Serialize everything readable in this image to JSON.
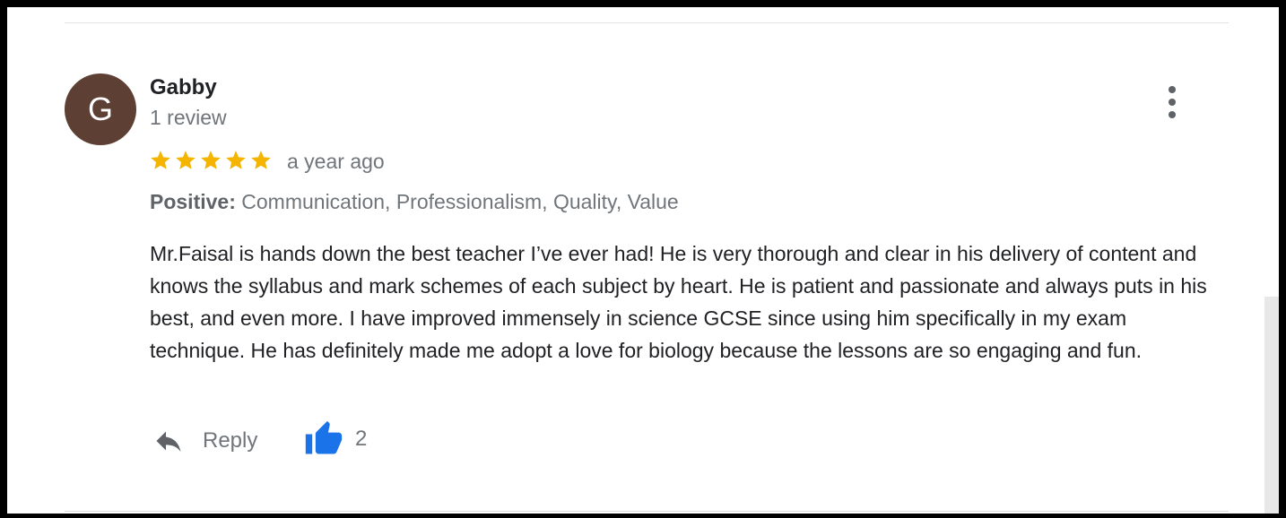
{
  "review": {
    "author": {
      "initial": "G",
      "name": "Gabby",
      "review_count": "1 review",
      "avatar_color": "#5d3f33"
    },
    "rating": 5,
    "date": "a year ago",
    "attributes": {
      "label": "Positive:",
      "values": "Communication, Professionalism, Quality, Value"
    },
    "text": "Mr.Faisal is hands down the best teacher I’ve ever had! He is very thorough and clear in his delivery of content and knows the syllabus and mark schemes of each subject by heart. He is patient and passionate and always puts in his best, and even more. I have improved immensely in science GCSE since using him specifically in my exam technique. He has definitely made me adopt a love for biology because the lessons are so engaging and fun.",
    "actions": {
      "reply_label": "Reply",
      "reply_icon": "reply-arrow-icon",
      "like_icon": "thumbs-up-icon",
      "like_count": "2"
    },
    "menu_icon": "more-vertical-icon"
  },
  "colors": {
    "star": "#f4b400",
    "like_blue": "#1a73e8",
    "secondary_text": "#70757a",
    "primary_text": "#202124"
  }
}
